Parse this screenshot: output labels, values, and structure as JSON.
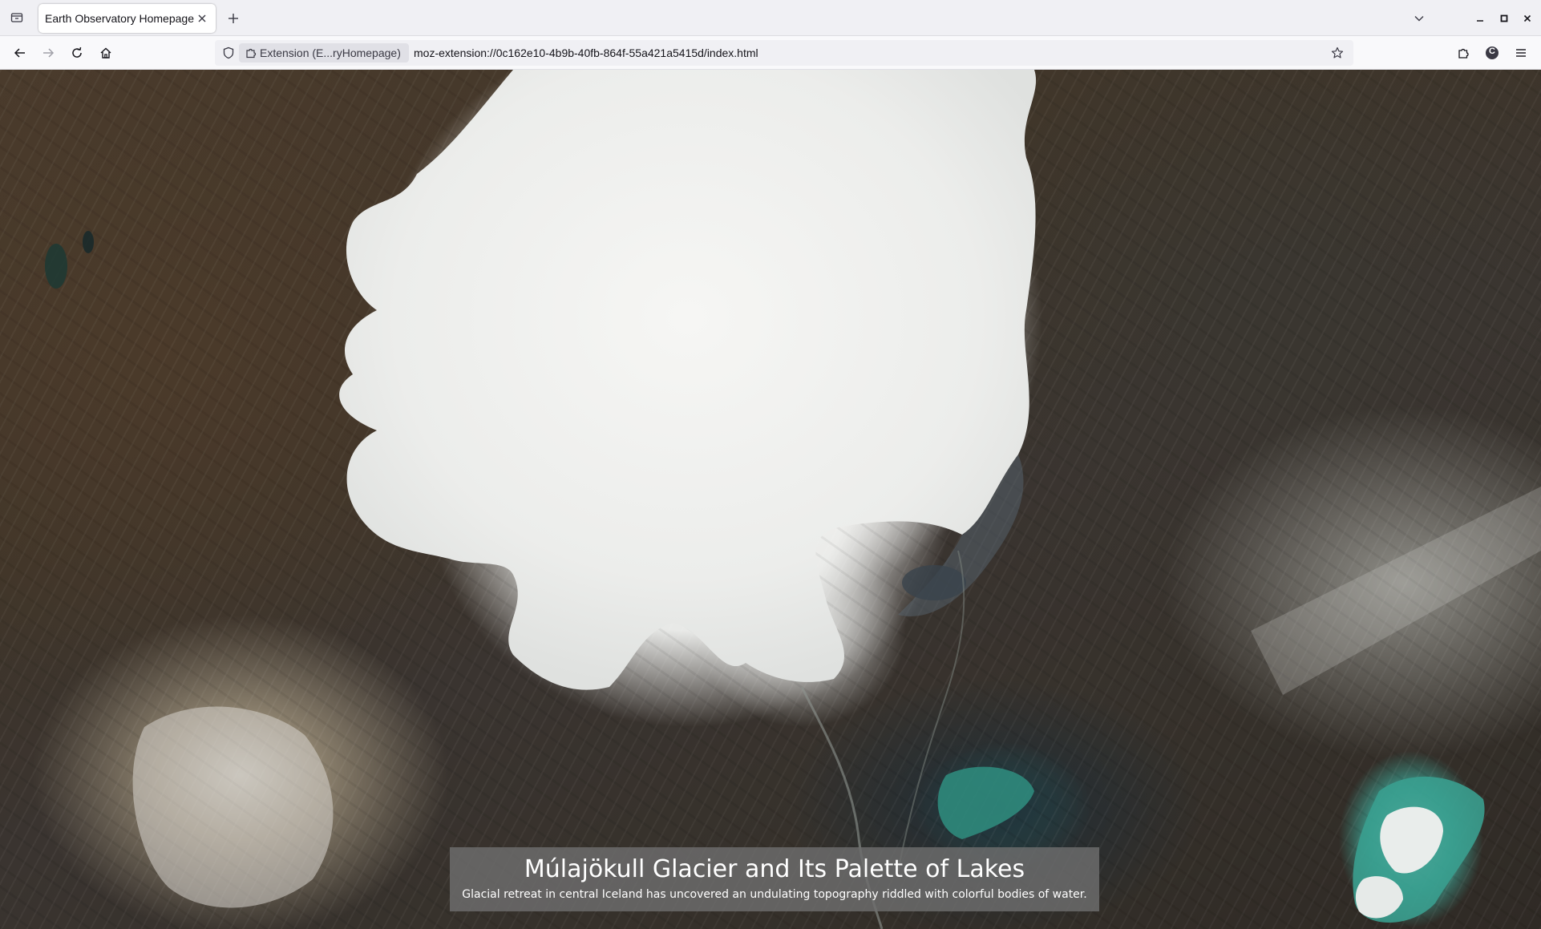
{
  "tab": {
    "title": "Earth Observatory Homepage",
    "close_icon": "close-icon"
  },
  "tabstrip": {
    "list_all_tabs_icon": "tabs-list-icon",
    "new_tab_icon": "plus-icon",
    "overflow_icon": "chevron-down-icon"
  },
  "window_controls": {
    "minimize_icon": "minimize-icon",
    "maximize_icon": "maximize-icon",
    "close_icon": "close-icon"
  },
  "navbar": {
    "back_icon": "arrow-left-icon",
    "forward_icon": "arrow-right-icon",
    "reload_icon": "reload-icon",
    "home_icon": "home-icon",
    "shield_icon": "shield-icon",
    "identity_label": "Extension (E...ryHomepage)",
    "url": "moz-extension://0c162e10-4b9b-40fb-864f-55a421a5415d/index.html",
    "bookmark_icon": "star-icon",
    "extensions_icon": "puzzle-icon",
    "account_avatar_letter": "C",
    "menu_icon": "hamburger-icon"
  },
  "colors": {
    "tabstrip_bg": "#f0f0f4",
    "navbar_bg": "#f9f9fb",
    "urlbar_bg": "#f0f0f4",
    "caption_bg": "#6e6e6e"
  },
  "caption": {
    "title": "Múlajökull Glacier and Its Palette of Lakes",
    "subtitle": "Glacial retreat in central Iceland has uncovered an undulating topography riddled with colorful bodies of water."
  }
}
